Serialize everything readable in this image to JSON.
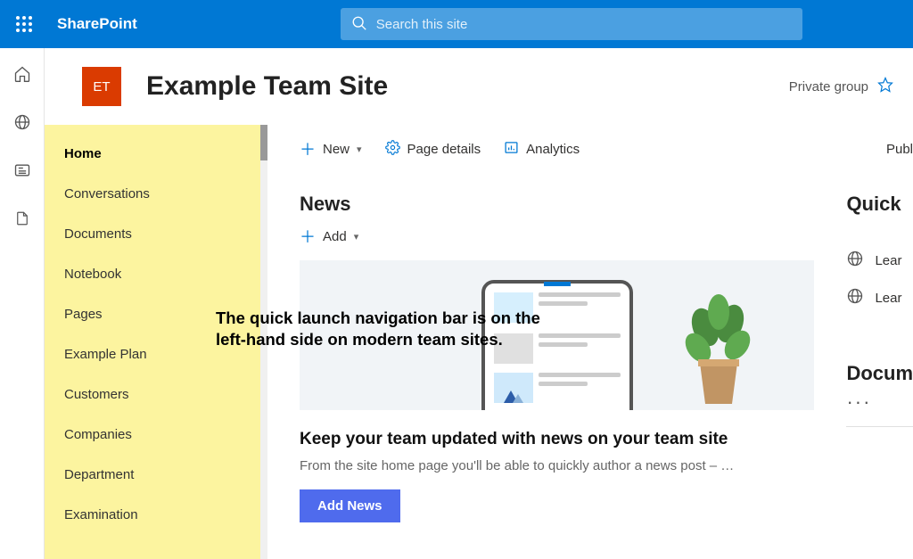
{
  "app": {
    "name": "SharePoint"
  },
  "search": {
    "placeholder": "Search this site"
  },
  "site": {
    "logo_text": "ET",
    "title": "Example Team Site",
    "privacy": "Private group"
  },
  "quick_launch": [
    {
      "label": "Home",
      "active": true
    },
    {
      "label": "Conversations",
      "active": false
    },
    {
      "label": "Documents",
      "active": false
    },
    {
      "label": "Notebook",
      "active": false
    },
    {
      "label": "Pages",
      "active": false
    },
    {
      "label": "Example Plan",
      "active": false
    },
    {
      "label": "Customers",
      "active": false
    },
    {
      "label": "Companies",
      "active": false
    },
    {
      "label": "Department",
      "active": false
    },
    {
      "label": "Examination",
      "active": false
    }
  ],
  "toolbar": {
    "new_label": "New",
    "page_details_label": "Page details",
    "analytics_label": "Analytics",
    "publish_label": "Publ"
  },
  "news": {
    "heading": "News",
    "add_label": "Add",
    "headline": "Keep your team updated with news on your team site",
    "subtext": "From the site home page you'll be able to quickly author a news post – …",
    "button": "Add News"
  },
  "quick_section": {
    "heading": "Quick ",
    "links": [
      {
        "label": "Lear"
      },
      {
        "label": "Lear"
      }
    ]
  },
  "documents": {
    "heading": "Docum",
    "ellipsis": "···"
  },
  "annotation": {
    "line1": "The quick launch navigation bar is on the",
    "line2": "left-hand side on modern team sites."
  }
}
